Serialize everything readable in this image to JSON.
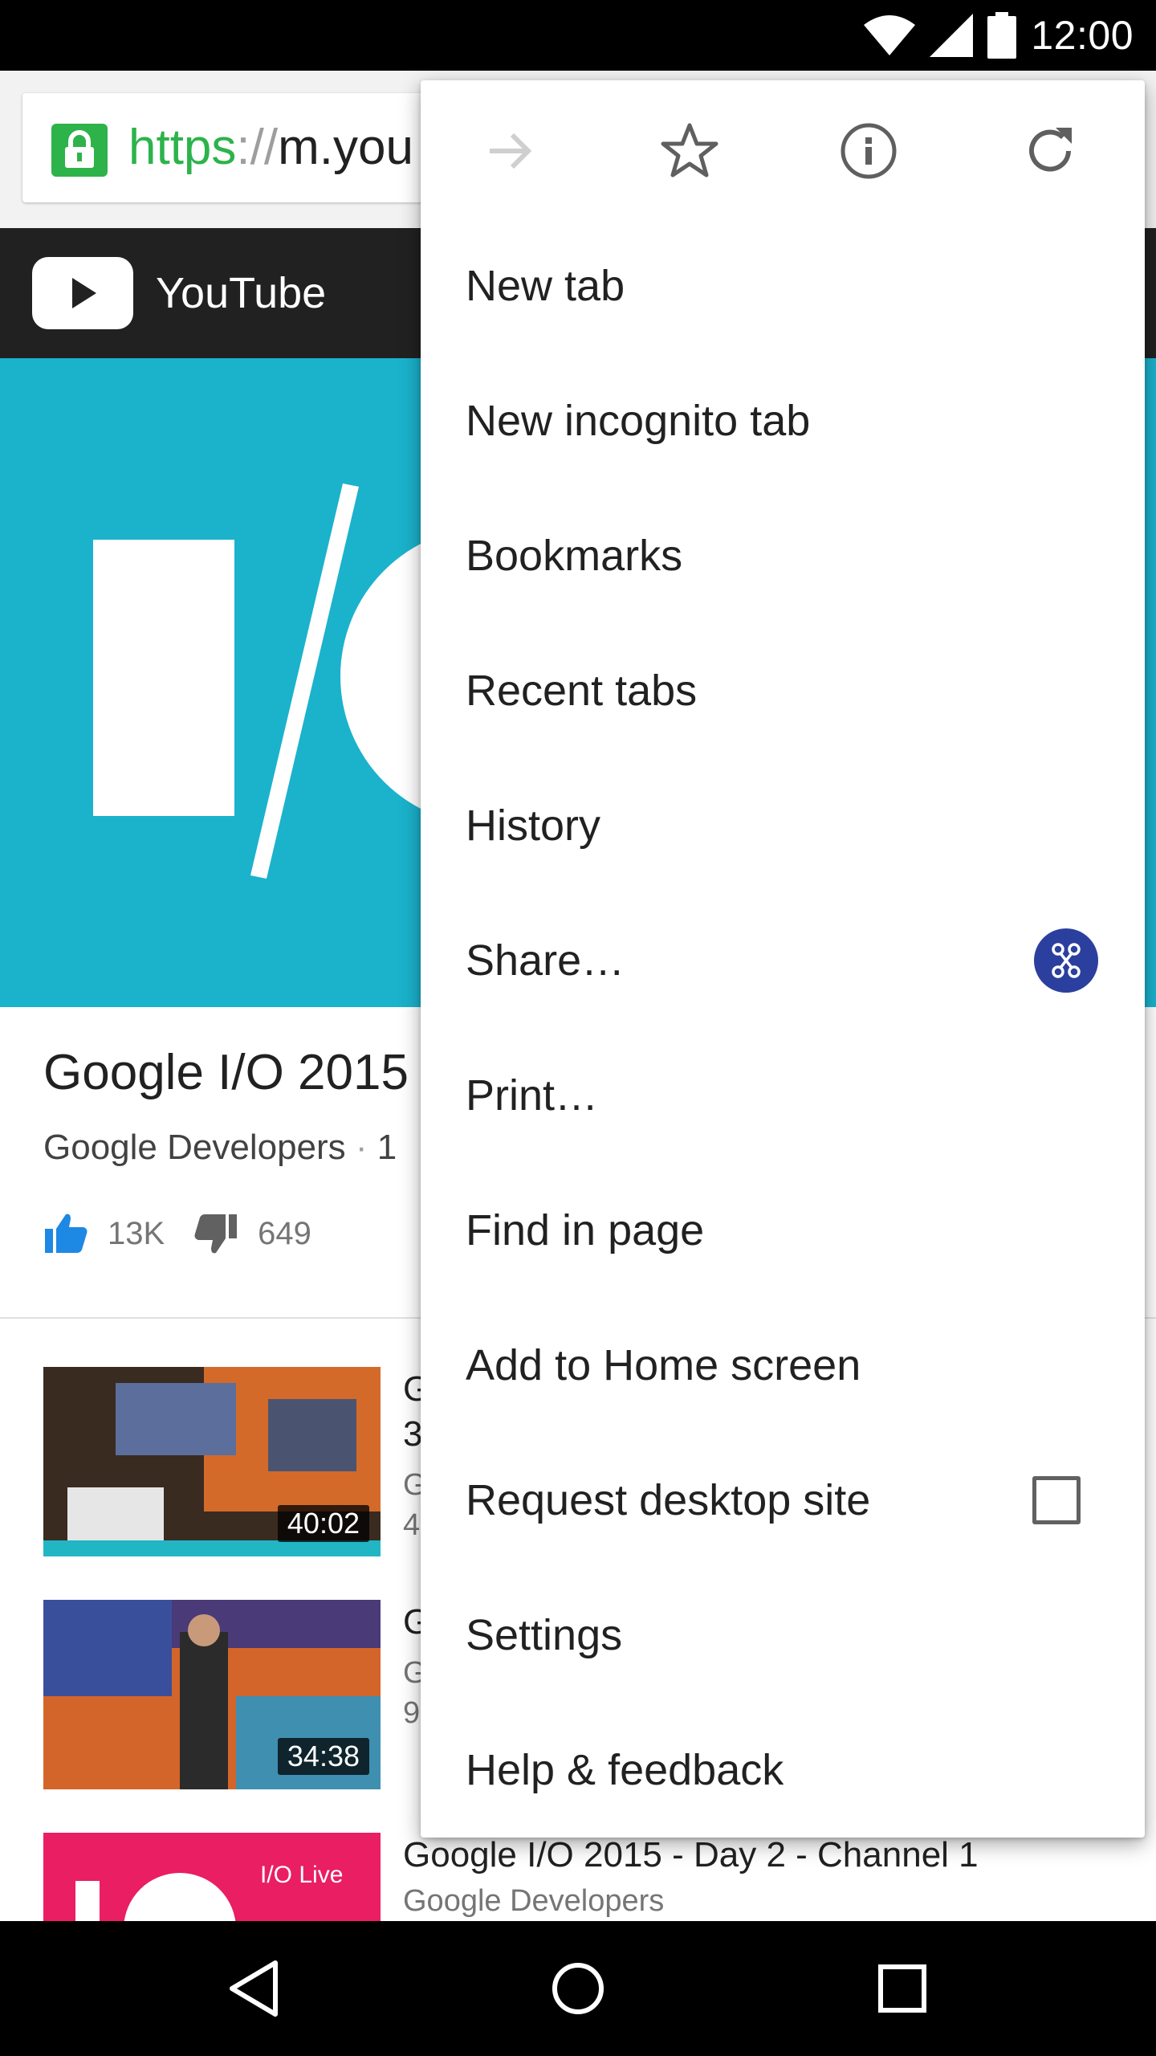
{
  "status_bar": {
    "time": "12:00",
    "icons": [
      "wifi-icon",
      "cell-signal-icon",
      "battery-icon"
    ]
  },
  "omnibox": {
    "url_scheme": "https",
    "url_separator": "://",
    "url_host": "m.you",
    "security": "lock-icon"
  },
  "youtube": {
    "title": "YouTube"
  },
  "video": {
    "title": "Google I/O 2015",
    "channel": "Google Developers",
    "dot": "·",
    "channel_suffix": "1",
    "likes": "13K",
    "dislikes": "649"
  },
  "related": [
    {
      "duration": "40:02",
      "title_line1": "G",
      "title_line2": "3",
      "meta_line1": "G",
      "meta_line2": "4"
    },
    {
      "duration": "34:38",
      "title_line1": "G",
      "meta_line1": "G",
      "meta_line2": "9"
    },
    {
      "thumb_text": "I/O Live",
      "title_line1": "Google I/O 2015 - Day 2 - Channel 1",
      "meta_line1": "Google Developers"
    }
  ],
  "menu": {
    "icon_row": [
      "forward-icon",
      "bookmark-star-icon",
      "page-info-icon",
      "reload-icon"
    ],
    "items": [
      {
        "label": "New tab"
      },
      {
        "label": "New incognito tab"
      },
      {
        "label": "Bookmarks"
      },
      {
        "label": "Recent tabs"
      },
      {
        "label": "History"
      },
      {
        "label": "Share…"
      },
      {
        "label": "Print…"
      },
      {
        "label": "Find in page"
      },
      {
        "label": "Add to Home screen"
      },
      {
        "label": "Request desktop site",
        "checked": false
      },
      {
        "label": "Settings"
      },
      {
        "label": "Help & feedback"
      }
    ]
  },
  "nav_bar": {
    "buttons": [
      "back-icon",
      "home-icon",
      "recents-icon"
    ]
  },
  "colors": {
    "secure_green": "#2db34a",
    "youtube_header": "#212121",
    "player_bg": "#1bb2cc",
    "like_blue": "#1e88e5",
    "share_badge": "#2b3f9e"
  }
}
